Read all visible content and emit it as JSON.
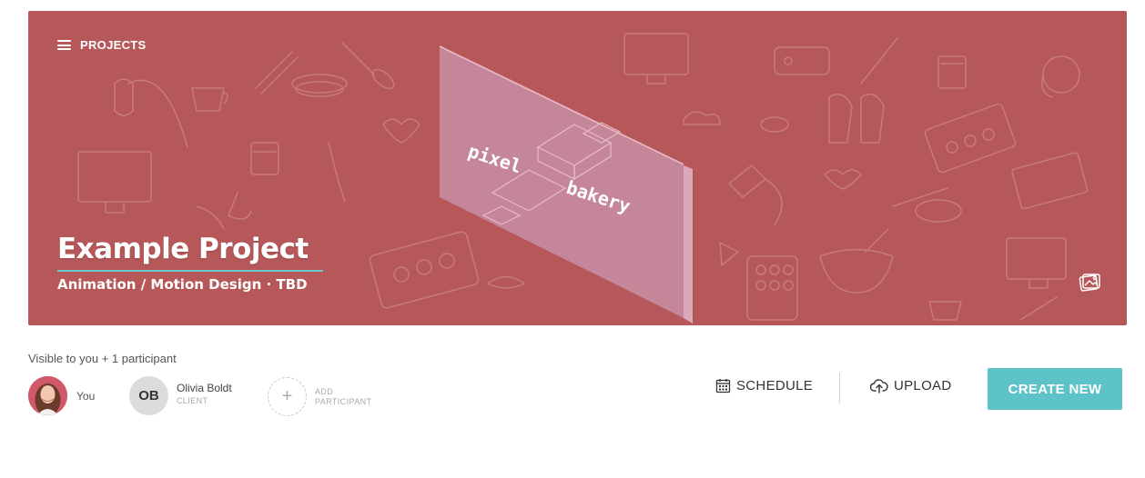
{
  "nav": {
    "label": "PROJECTS"
  },
  "hero": {
    "title": "Example Project",
    "subtitle": "Animation / Motion Design · TBD",
    "artwork_text": [
      "pixel",
      "bakery"
    ],
    "background_color": "#b6585a",
    "accent_line_color": "#6fc6cc"
  },
  "participants": {
    "visibility_text": "Visible to you + 1 participant",
    "you_label": "You",
    "client": {
      "initials": "OB",
      "name": "Olivia Boldt",
      "role": "CLIENT"
    },
    "add": {
      "line1": "ADD",
      "line2": "PARTICIPANT"
    }
  },
  "actions": {
    "schedule": "SCHEDULE",
    "upload": "UPLOAD",
    "create_new": "CREATE NEW",
    "create_color": "#5ec3c8"
  },
  "icons": [
    "hamburger-icon",
    "image-icon",
    "calendar-icon",
    "cloud-upload-icon",
    "plus-icon"
  ]
}
